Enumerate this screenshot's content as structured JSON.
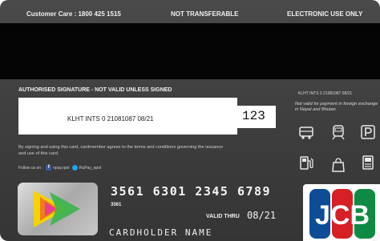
{
  "topbar": {
    "customer_care": "Customer Care : 1800 425 1515",
    "not_transferable": "NOT TRANSFERABLE",
    "electronic_use": "ELECTRONIC USE ONLY"
  },
  "signature": {
    "title": "AUTHORISED SIGNATURE  -  NOT VALID UNLESS SIGNED",
    "text": "KLHT INTS 0 21081087 08/21",
    "cvv": "123"
  },
  "agreement": "By signing and using this card, cardmember agrees to the terms and conditions governing the issuance and use of this card.",
  "follow": {
    "label": "Follow us on :",
    "facebook": "npay.rpol",
    "twitter": "RuPay_npol"
  },
  "right_panel": {
    "ref": "KLHT INTS 0 21081087 08/21",
    "note": "Not valid for payment in foreign exchange in Nepal and Bhutan"
  },
  "services": [
    "bus-icon",
    "train-icon",
    "parking-icon",
    "fuel-icon",
    "shopping-bag-icon",
    "kiosk-icon"
  ],
  "card": {
    "number": "3561 6301 2345 6789",
    "bin": "3561",
    "valid_thru_label": "VALID THRU",
    "valid_thru": "08/21",
    "holder": "CARDHOLDER NAME"
  },
  "logo": {
    "brand": "JCB"
  },
  "colors": {
    "card_bg": "#3c3c3c",
    "magnetic_stripe": "#050505",
    "jcb_blue": "#0e4c96",
    "jcb_red": "#d71f26",
    "jcb_green": "#0f8a44",
    "chip_yellow": "#f3d400",
    "chip_orange": "#f07c1e",
    "chip_green": "#39b54a"
  }
}
